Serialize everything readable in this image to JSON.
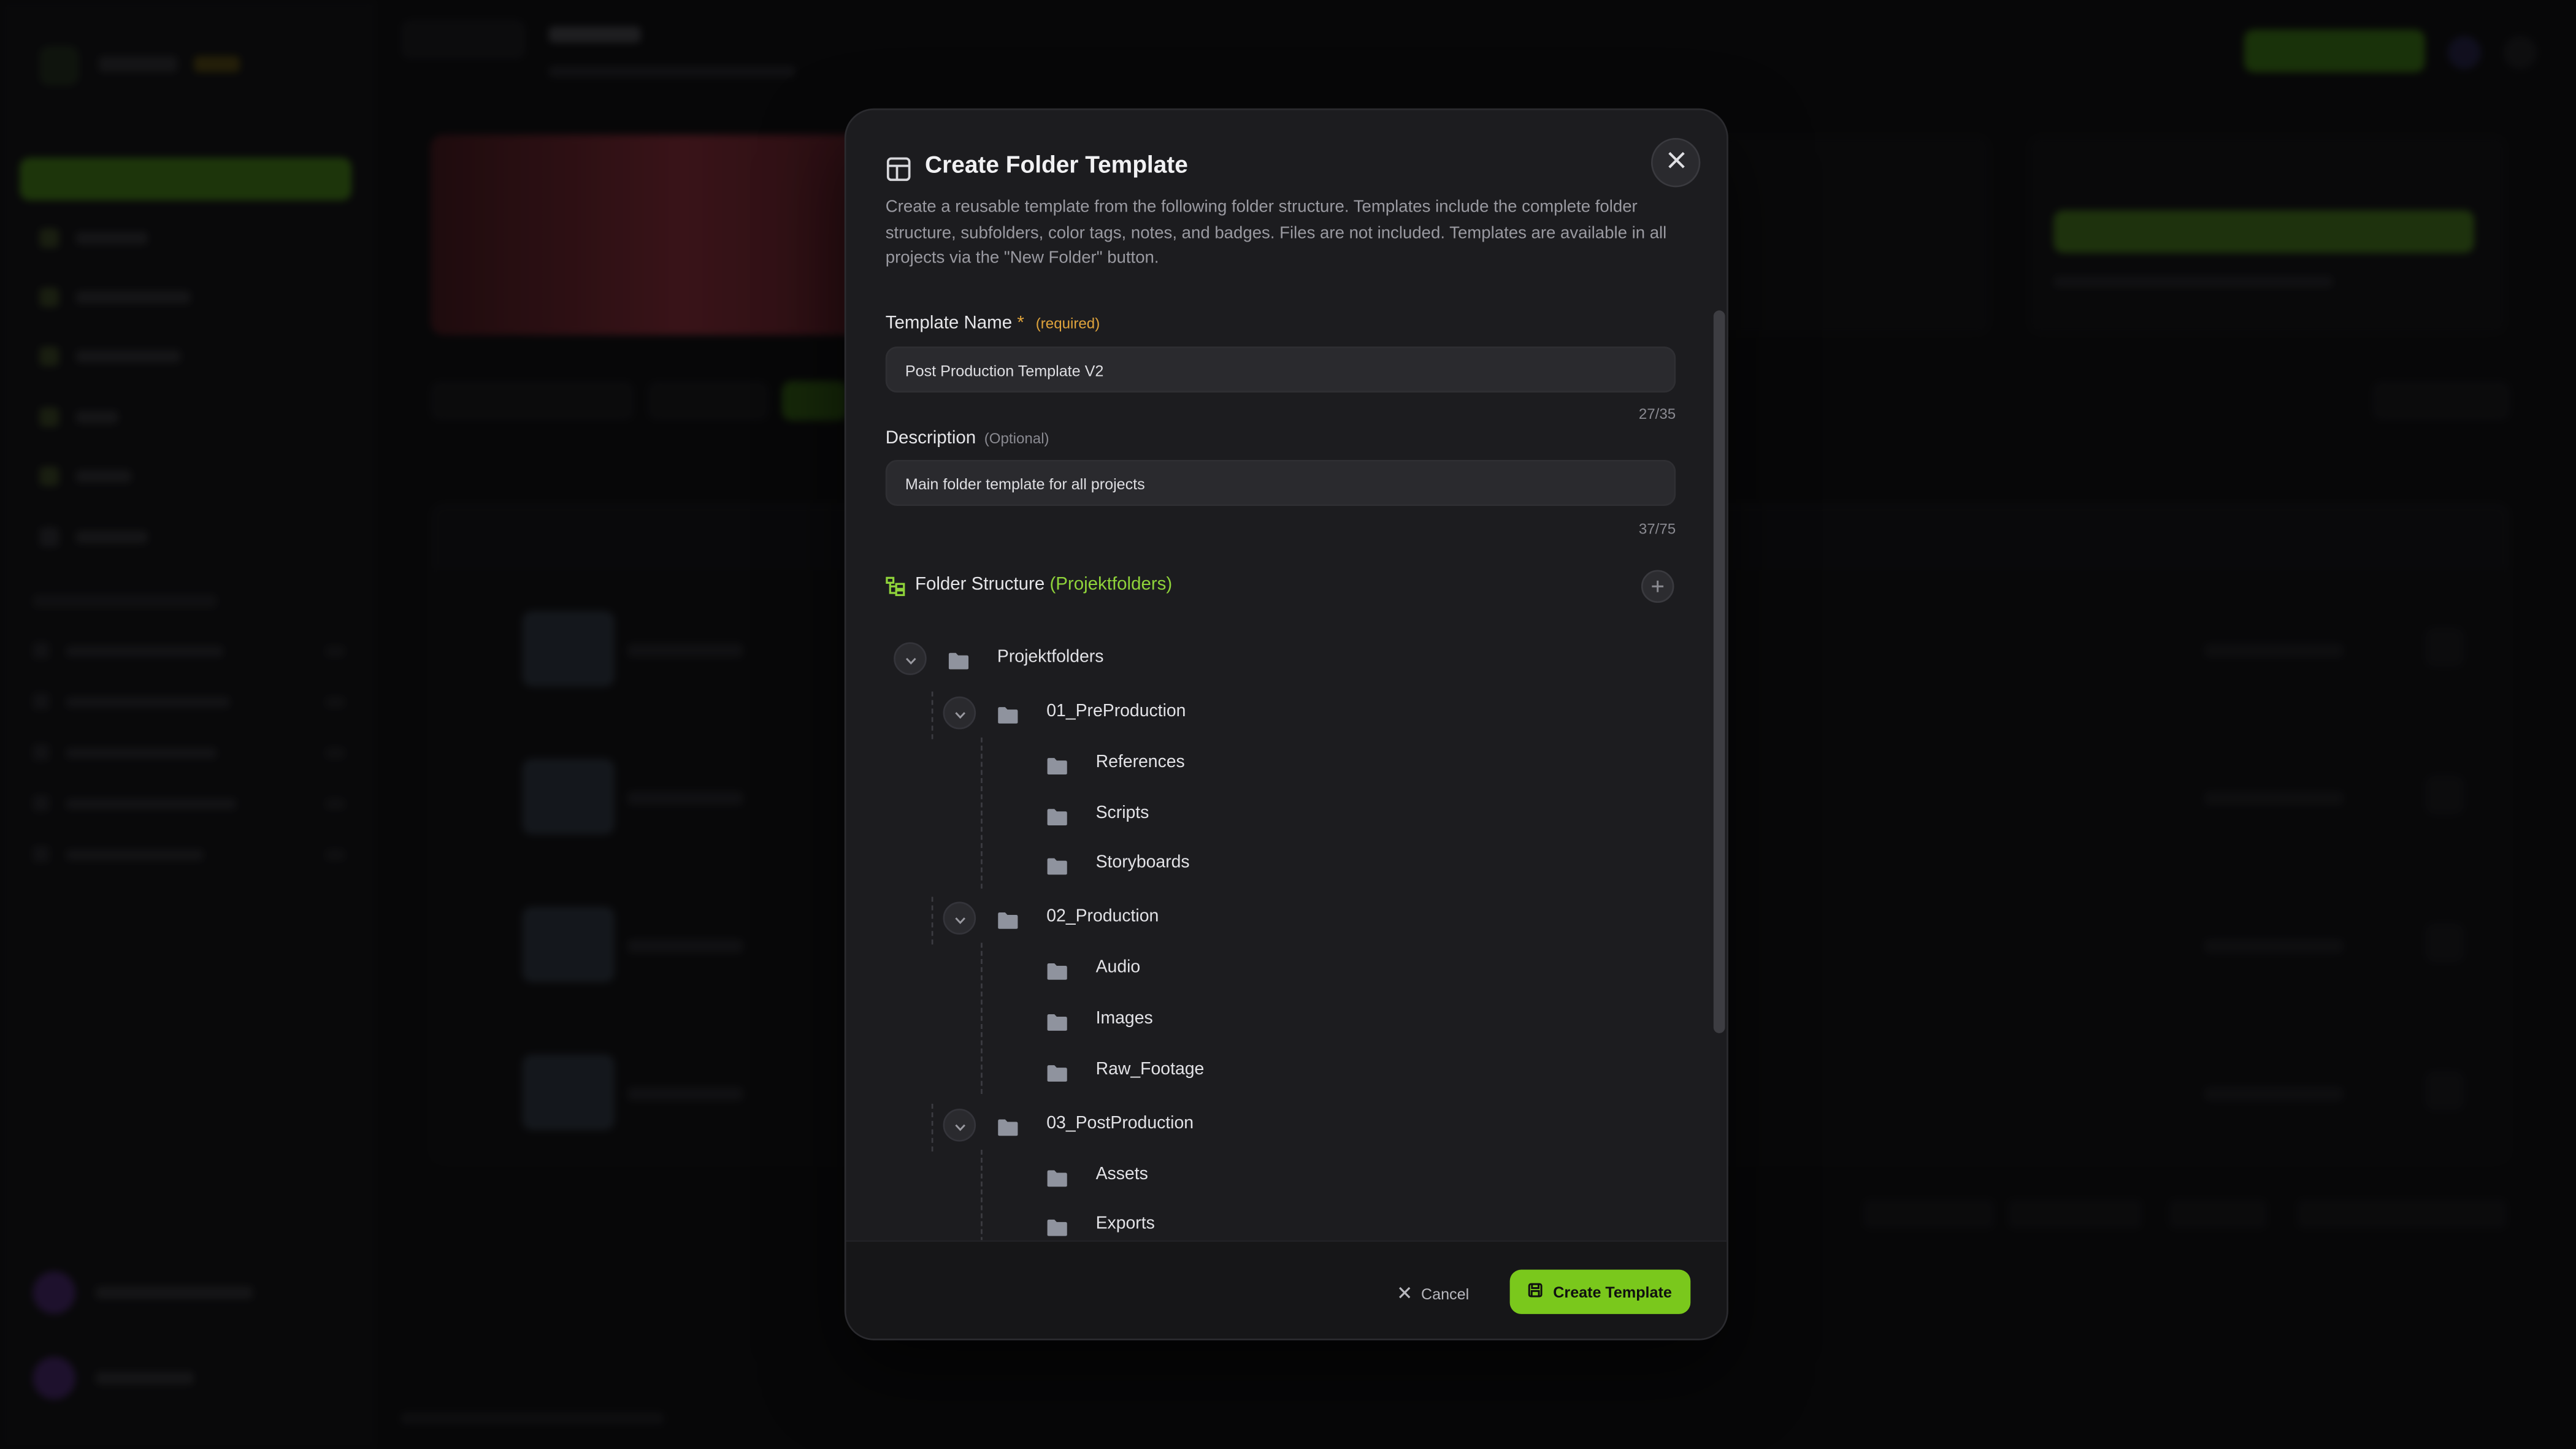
{
  "colors": {
    "accent": "#7ac81c",
    "accent_text": "#8fd33a",
    "required": "#e0a43c",
    "modal_bg": "#1c1c1f",
    "input_bg": "#2a2a2e"
  },
  "modal": {
    "title": "Create Folder Template",
    "title_icon": "template-layout-icon",
    "close_icon": "close-icon",
    "description": "Create a reusable template from the following folder structure. Templates include the complete folder structure, subfolders, color tags, notes, and badges. Files are not included. Templates are available in all projects via the \"New Folder\" button.",
    "template_name": {
      "label": "Template Name",
      "required_star": "*",
      "required_note": "(required)",
      "value": "Post Production Template V2",
      "counter": "27/35"
    },
    "description_field": {
      "label": "Description",
      "optional_note": "(Optional)",
      "value": "Main folder template for all projects",
      "counter": "37/75"
    },
    "folder_structure": {
      "label": "Folder Structure",
      "root_name": "(Projektfolders)",
      "icon": "folder-tree-icon",
      "add_icon": "plus-icon",
      "root": "Projektfolders",
      "groups": [
        {
          "name": "01_PreProduction",
          "children": [
            "References",
            "Scripts",
            "Storyboards"
          ]
        },
        {
          "name": "02_Production",
          "children": [
            "Audio",
            "Images",
            "Raw_Footage"
          ]
        },
        {
          "name": "03_PostProduction",
          "children": [
            "Assets",
            "Exports"
          ]
        }
      ]
    },
    "footer": {
      "cancel_label": "Cancel",
      "cancel_icon": "x-icon",
      "create_label": "Create Template",
      "create_icon": "save-icon"
    }
  }
}
